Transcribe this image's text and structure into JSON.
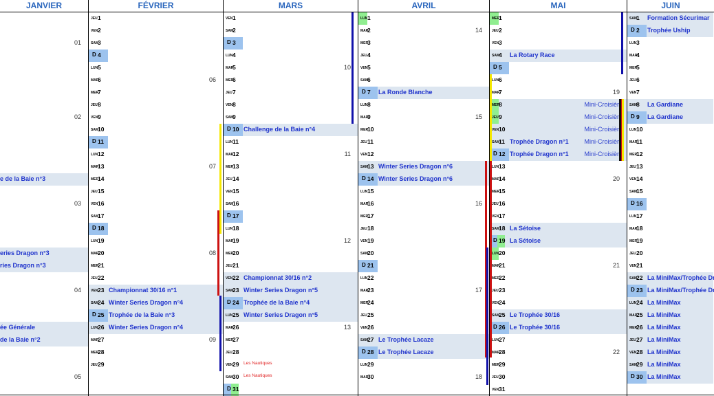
{
  "months": [
    "JANVIER",
    "FÉVRIER",
    "MARS",
    "AVRIL",
    "MAI",
    "JUIN"
  ],
  "janvier": {
    "weeks": [
      "01",
      "02",
      "03",
      "04",
      "05"
    ],
    "events": [
      "e de la Baie n°3",
      "eries Dragon n°3",
      "ries Dragon n°3",
      "ée Générale",
      "de la Baie n°2"
    ]
  },
  "fevrier": {
    "weeks": [
      "06",
      "07",
      "08",
      "09"
    ],
    "days": [
      {
        "dow": "JEU",
        "n": "1"
      },
      {
        "dow": "VEN",
        "n": "2"
      },
      {
        "dow": "SAM",
        "n": "3"
      },
      {
        "dow": "D",
        "n": "4"
      },
      {
        "dow": "LUN",
        "n": "5"
      },
      {
        "dow": "MAR",
        "n": "6"
      },
      {
        "dow": "MER",
        "n": "7"
      },
      {
        "dow": "JEU",
        "n": "8"
      },
      {
        "dow": "VEN",
        "n": "9"
      },
      {
        "dow": "SAM",
        "n": "10"
      },
      {
        "dow": "D",
        "n": "11"
      },
      {
        "dow": "LUN",
        "n": "12"
      },
      {
        "dow": "MAR",
        "n": "13"
      },
      {
        "dow": "MER",
        "n": "14"
      },
      {
        "dow": "JEU",
        "n": "15"
      },
      {
        "dow": "VEN",
        "n": "16"
      },
      {
        "dow": "SAM",
        "n": "17"
      },
      {
        "dow": "D",
        "n": "18"
      },
      {
        "dow": "LUN",
        "n": "19"
      },
      {
        "dow": "MAR",
        "n": "20"
      },
      {
        "dow": "MER",
        "n": "21"
      },
      {
        "dow": "JEU",
        "n": "22"
      },
      {
        "dow": "VEN",
        "n": "23",
        "ev": "Championnat 30/16 n°1"
      },
      {
        "dow": "SAM",
        "n": "24",
        "ev": "Winter Series Dragon n°4"
      },
      {
        "dow": "D",
        "n": "25",
        "ev": "Trophée de la Baie n°3"
      },
      {
        "dow": "LUN",
        "n": "26",
        "ev": "Winter Series Dragon n°4"
      },
      {
        "dow": "MAR",
        "n": "27"
      },
      {
        "dow": "MER",
        "n": "28"
      },
      {
        "dow": "JEU",
        "n": "29"
      }
    ]
  },
  "mars": {
    "weeks": [
      "10",
      "11",
      "12",
      "13"
    ],
    "days": [
      {
        "dow": "VEN",
        "n": "1"
      },
      {
        "dow": "SAM",
        "n": "2"
      },
      {
        "dow": "D",
        "n": "3"
      },
      {
        "dow": "LUN",
        "n": "4"
      },
      {
        "dow": "MAR",
        "n": "5"
      },
      {
        "dow": "MER",
        "n": "6"
      },
      {
        "dow": "JEU",
        "n": "7"
      },
      {
        "dow": "VEN",
        "n": "8"
      },
      {
        "dow": "SAM",
        "n": "9"
      },
      {
        "dow": "D",
        "n": "10",
        "ev": "Challenge de la Baie n°4"
      },
      {
        "dow": "LUN",
        "n": "11"
      },
      {
        "dow": "MAR",
        "n": "12"
      },
      {
        "dow": "MER",
        "n": "13"
      },
      {
        "dow": "JEU",
        "n": "14"
      },
      {
        "dow": "VEN",
        "n": "15"
      },
      {
        "dow": "SAM",
        "n": "16"
      },
      {
        "dow": "D",
        "n": "17"
      },
      {
        "dow": "LUN",
        "n": "18"
      },
      {
        "dow": "MAR",
        "n": "19"
      },
      {
        "dow": "MER",
        "n": "20"
      },
      {
        "dow": "JEU",
        "n": "21"
      },
      {
        "dow": "VEN",
        "n": "22",
        "ev": "Championnat 30/16 n°2"
      },
      {
        "dow": "SAM",
        "n": "23",
        "ev": "Winter Series Dragon n°5"
      },
      {
        "dow": "D",
        "n": "24",
        "ev": "Trophée de la Baie n°4"
      },
      {
        "dow": "LUN",
        "n": "25",
        "ev": "Winter Series Dragon n°5"
      },
      {
        "dow": "MAR",
        "n": "26"
      },
      {
        "dow": "MER",
        "n": "27"
      },
      {
        "dow": "JEU",
        "n": "28"
      },
      {
        "dow": "VEN",
        "n": "29",
        "red": "Les Nautiques"
      },
      {
        "dow": "SAM",
        "n": "30",
        "red": "Les Nautiques"
      },
      {
        "dow": "D",
        "n": "31"
      }
    ]
  },
  "avril": {
    "weeks": [
      "14",
      "15",
      "16",
      "17",
      "18"
    ],
    "days": [
      {
        "dow": "LUN",
        "n": "1"
      },
      {
        "dow": "MAR",
        "n": "2"
      },
      {
        "dow": "MER",
        "n": "3"
      },
      {
        "dow": "JEU",
        "n": "4"
      },
      {
        "dow": "VEN",
        "n": "5"
      },
      {
        "dow": "SAM",
        "n": "6"
      },
      {
        "dow": "D",
        "n": "7",
        "ev": "La Ronde Blanche"
      },
      {
        "dow": "LUN",
        "n": "8"
      },
      {
        "dow": "MAR",
        "n": "9"
      },
      {
        "dow": "MER",
        "n": "10"
      },
      {
        "dow": "JEU",
        "n": "11"
      },
      {
        "dow": "VEN",
        "n": "12"
      },
      {
        "dow": "SAM",
        "n": "13",
        "ev": "Winter Series Dragon n°6"
      },
      {
        "dow": "D",
        "n": "14",
        "ev": "Winter Series Dragon n°6"
      },
      {
        "dow": "LUN",
        "n": "15"
      },
      {
        "dow": "MAR",
        "n": "16"
      },
      {
        "dow": "MER",
        "n": "17"
      },
      {
        "dow": "JEU",
        "n": "18"
      },
      {
        "dow": "VEN",
        "n": "19"
      },
      {
        "dow": "SAM",
        "n": "20"
      },
      {
        "dow": "D",
        "n": "21"
      },
      {
        "dow": "LUN",
        "n": "22"
      },
      {
        "dow": "MAR",
        "n": "23"
      },
      {
        "dow": "MER",
        "n": "24"
      },
      {
        "dow": "JEU",
        "n": "25"
      },
      {
        "dow": "VEN",
        "n": "26"
      },
      {
        "dow": "SAM",
        "n": "27",
        "ev": "Le Trophée Lacaze"
      },
      {
        "dow": "D",
        "n": "28",
        "ev": "Le Trophée Lacaze"
      },
      {
        "dow": "LUN",
        "n": "29"
      },
      {
        "dow": "MAR",
        "n": "30"
      }
    ]
  },
  "mai": {
    "weeks": [
      "19",
      "20",
      "21",
      "22"
    ],
    "days": [
      {
        "dow": "MER",
        "n": "1"
      },
      {
        "dow": "JEU",
        "n": "2"
      },
      {
        "dow": "VEN",
        "n": "3"
      },
      {
        "dow": "SAM",
        "n": "4",
        "ev": "La Rotary Race"
      },
      {
        "dow": "D",
        "n": "5"
      },
      {
        "dow": "LUN",
        "n": "6"
      },
      {
        "dow": "MAR",
        "n": "7"
      },
      {
        "dow": "MER",
        "n": "8",
        "right": "Mini-Croisière"
      },
      {
        "dow": "JEU",
        "n": "9",
        "right": "Mini-Croisière"
      },
      {
        "dow": "VEN",
        "n": "10",
        "right": "Mini-Croisière"
      },
      {
        "dow": "SAM",
        "n": "11",
        "ev": "Trophée Dragon n°1",
        "right": "Mini-Croisière"
      },
      {
        "dow": "D",
        "n": "12",
        "ev": "Trophée Dragon n°1",
        "right": "Mini-Croisière"
      },
      {
        "dow": "LUN",
        "n": "13"
      },
      {
        "dow": "MAR",
        "n": "14"
      },
      {
        "dow": "MER",
        "n": "15"
      },
      {
        "dow": "JEU",
        "n": "16"
      },
      {
        "dow": "VEN",
        "n": "17"
      },
      {
        "dow": "SAM",
        "n": "18",
        "ev": "La Sétoise"
      },
      {
        "dow": "D",
        "n": "19",
        "ev": "La Sétoise"
      },
      {
        "dow": "LUN",
        "n": "20"
      },
      {
        "dow": "MAR",
        "n": "21"
      },
      {
        "dow": "MER",
        "n": "22"
      },
      {
        "dow": "JEU",
        "n": "23"
      },
      {
        "dow": "VEN",
        "n": "24"
      },
      {
        "dow": "SAM",
        "n": "25",
        "ev": "Le Trophée 30/16"
      },
      {
        "dow": "D",
        "n": "26",
        "ev": "Le Trophée 30/16"
      },
      {
        "dow": "LUN",
        "n": "27"
      },
      {
        "dow": "MAR",
        "n": "28"
      },
      {
        "dow": "MER",
        "n": "29"
      },
      {
        "dow": "JEU",
        "n": "30"
      },
      {
        "dow": "VEN",
        "n": "31"
      }
    ]
  },
  "juin": {
    "days": [
      {
        "dow": "SAM",
        "n": "1",
        "ev": "Formation Sécurimar"
      },
      {
        "dow": "D",
        "n": "2",
        "ev": "Trophée Uship"
      },
      {
        "dow": "LUN",
        "n": "3"
      },
      {
        "dow": "MAR",
        "n": "4"
      },
      {
        "dow": "MER",
        "n": "5"
      },
      {
        "dow": "JEU",
        "n": "6"
      },
      {
        "dow": "VEN",
        "n": "7"
      },
      {
        "dow": "SAM",
        "n": "8",
        "ev": "La Gardiane"
      },
      {
        "dow": "D",
        "n": "9",
        "ev": "La Gardiane"
      },
      {
        "dow": "LUN",
        "n": "10"
      },
      {
        "dow": "MAR",
        "n": "11"
      },
      {
        "dow": "MER",
        "n": "12"
      },
      {
        "dow": "JEU",
        "n": "13"
      },
      {
        "dow": "VEN",
        "n": "14"
      },
      {
        "dow": "SAM",
        "n": "15"
      },
      {
        "dow": "D",
        "n": "16"
      },
      {
        "dow": "LUN",
        "n": "17"
      },
      {
        "dow": "MAR",
        "n": "18"
      },
      {
        "dow": "MER",
        "n": "19"
      },
      {
        "dow": "JEU",
        "n": "20"
      },
      {
        "dow": "VEN",
        "n": "21"
      },
      {
        "dow": "SAM",
        "n": "22",
        "ev": "La MiniMax/Trophée Dr"
      },
      {
        "dow": "D",
        "n": "23",
        "ev": "La MiniMax/Trophée Dr"
      },
      {
        "dow": "LUN",
        "n": "24",
        "ev": "La MiniMax"
      },
      {
        "dow": "MAR",
        "n": "25",
        "ev": "La MiniMax"
      },
      {
        "dow": "MER",
        "n": "26",
        "ev": "La MiniMax"
      },
      {
        "dow": "JEU",
        "n": "27",
        "ev": "La MiniMax"
      },
      {
        "dow": "VEN",
        "n": "28",
        "ev": "La MiniMax"
      },
      {
        "dow": "SAM",
        "n": "29",
        "ev": "La MiniMax"
      },
      {
        "dow": "D",
        "n": "30",
        "ev": "La MiniMax"
      }
    ]
  },
  "colors": {
    "header": "#2a66bd",
    "event_text": "#1f33cc",
    "event_bg": "#dde6f0",
    "sunday": "#9dc3ee",
    "green": "#90ee90",
    "red_text": "#e02020",
    "bar_blue": "#1111aa",
    "bar_red": "#cc1111",
    "bar_yellow": "#f5e800",
    "bar_black": "#111111"
  }
}
